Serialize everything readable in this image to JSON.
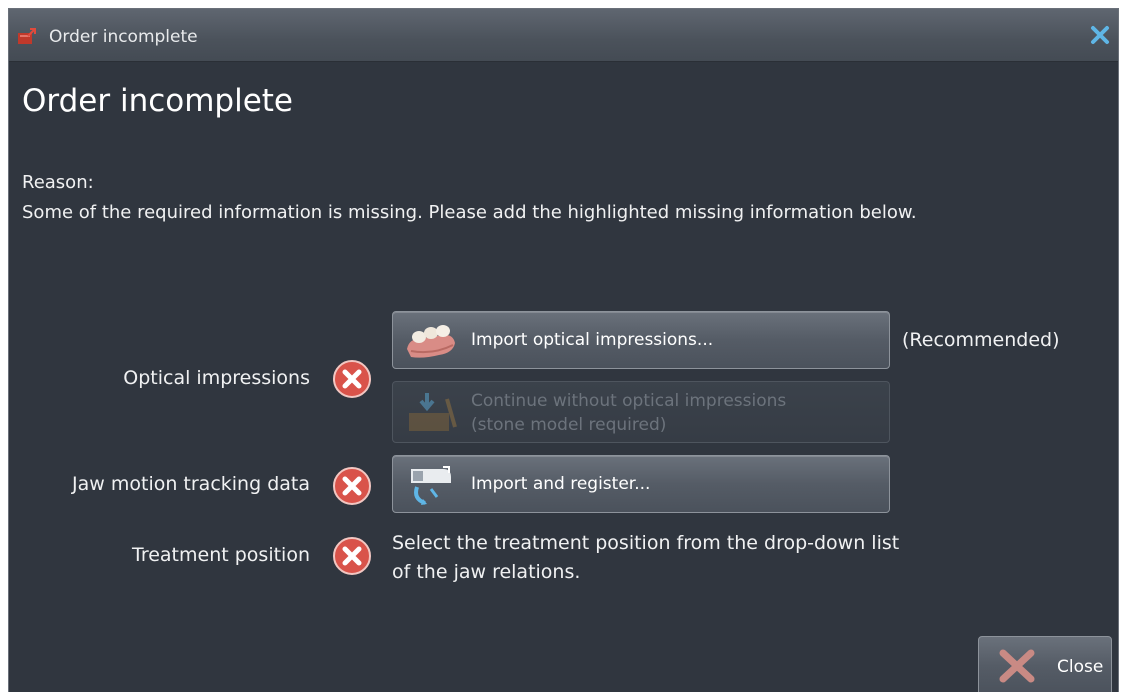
{
  "window": {
    "title": "Order incomplete",
    "close_icon": "close-icon"
  },
  "heading": "Order incomplete",
  "reason": {
    "label": "Reason:",
    "text": "Some of the required information is missing. Please add the highlighted missing information below."
  },
  "rows": {
    "optical": {
      "label": "Optical impressions",
      "status_icon": "error-icon"
    },
    "jaw": {
      "label": "Jaw motion tracking data",
      "status_icon": "error-icon"
    },
    "treatment": {
      "label": "Treatment position",
      "status_icon": "error-icon"
    }
  },
  "buttons": {
    "import_optical": {
      "label": "Import optical impressions...",
      "icon": "dental-impression-icon"
    },
    "continue_without": {
      "label_line1": "Continue without optical impressions",
      "label_line2": "(stone model required)",
      "icon": "stone-model-icon",
      "enabled": false
    },
    "import_register": {
      "label": "Import and register...",
      "icon": "jaw-tracking-icon"
    }
  },
  "recommended": "(Recommended)",
  "treatment_hint": "Select the treatment position from the drop-down list of the jaw relations.",
  "footer": {
    "close_label": "Close"
  },
  "colors": {
    "window_bg": "#30363f",
    "error_red": "#d9534a",
    "accent_blue": "#5fb6e6"
  }
}
